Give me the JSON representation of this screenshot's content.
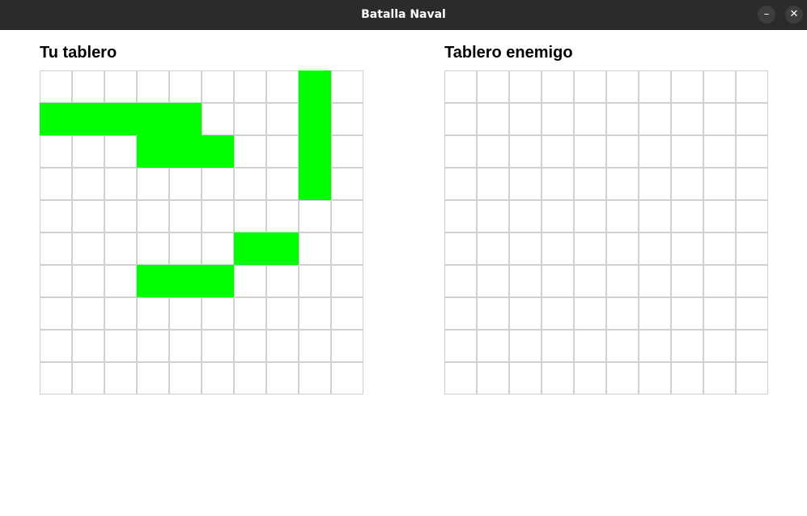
{
  "window": {
    "title": "Batalla Naval",
    "minimize_label": "–",
    "close_label": "✕"
  },
  "own_board": {
    "title": "Tu tablero",
    "rows": 10,
    "cols": 10,
    "ship_color": "#00ff00",
    "empty_color": "#ffffff",
    "grid_line_color": "#cfcfcf",
    "ships": [
      {
        "row": 0,
        "col": 8
      },
      {
        "row": 1,
        "col": 8
      },
      {
        "row": 2,
        "col": 8
      },
      {
        "row": 3,
        "col": 8
      },
      {
        "row": 1,
        "col": 0
      },
      {
        "row": 1,
        "col": 1
      },
      {
        "row": 1,
        "col": 2
      },
      {
        "row": 1,
        "col": 3
      },
      {
        "row": 1,
        "col": 4
      },
      {
        "row": 2,
        "col": 3
      },
      {
        "row": 2,
        "col": 4
      },
      {
        "row": 2,
        "col": 5
      },
      {
        "row": 5,
        "col": 6
      },
      {
        "row": 5,
        "col": 7
      },
      {
        "row": 6,
        "col": 3
      },
      {
        "row": 6,
        "col": 4
      },
      {
        "row": 6,
        "col": 5
      }
    ]
  },
  "enemy_board": {
    "title": "Tablero enemigo",
    "rows": 10,
    "cols": 10,
    "ships": []
  }
}
